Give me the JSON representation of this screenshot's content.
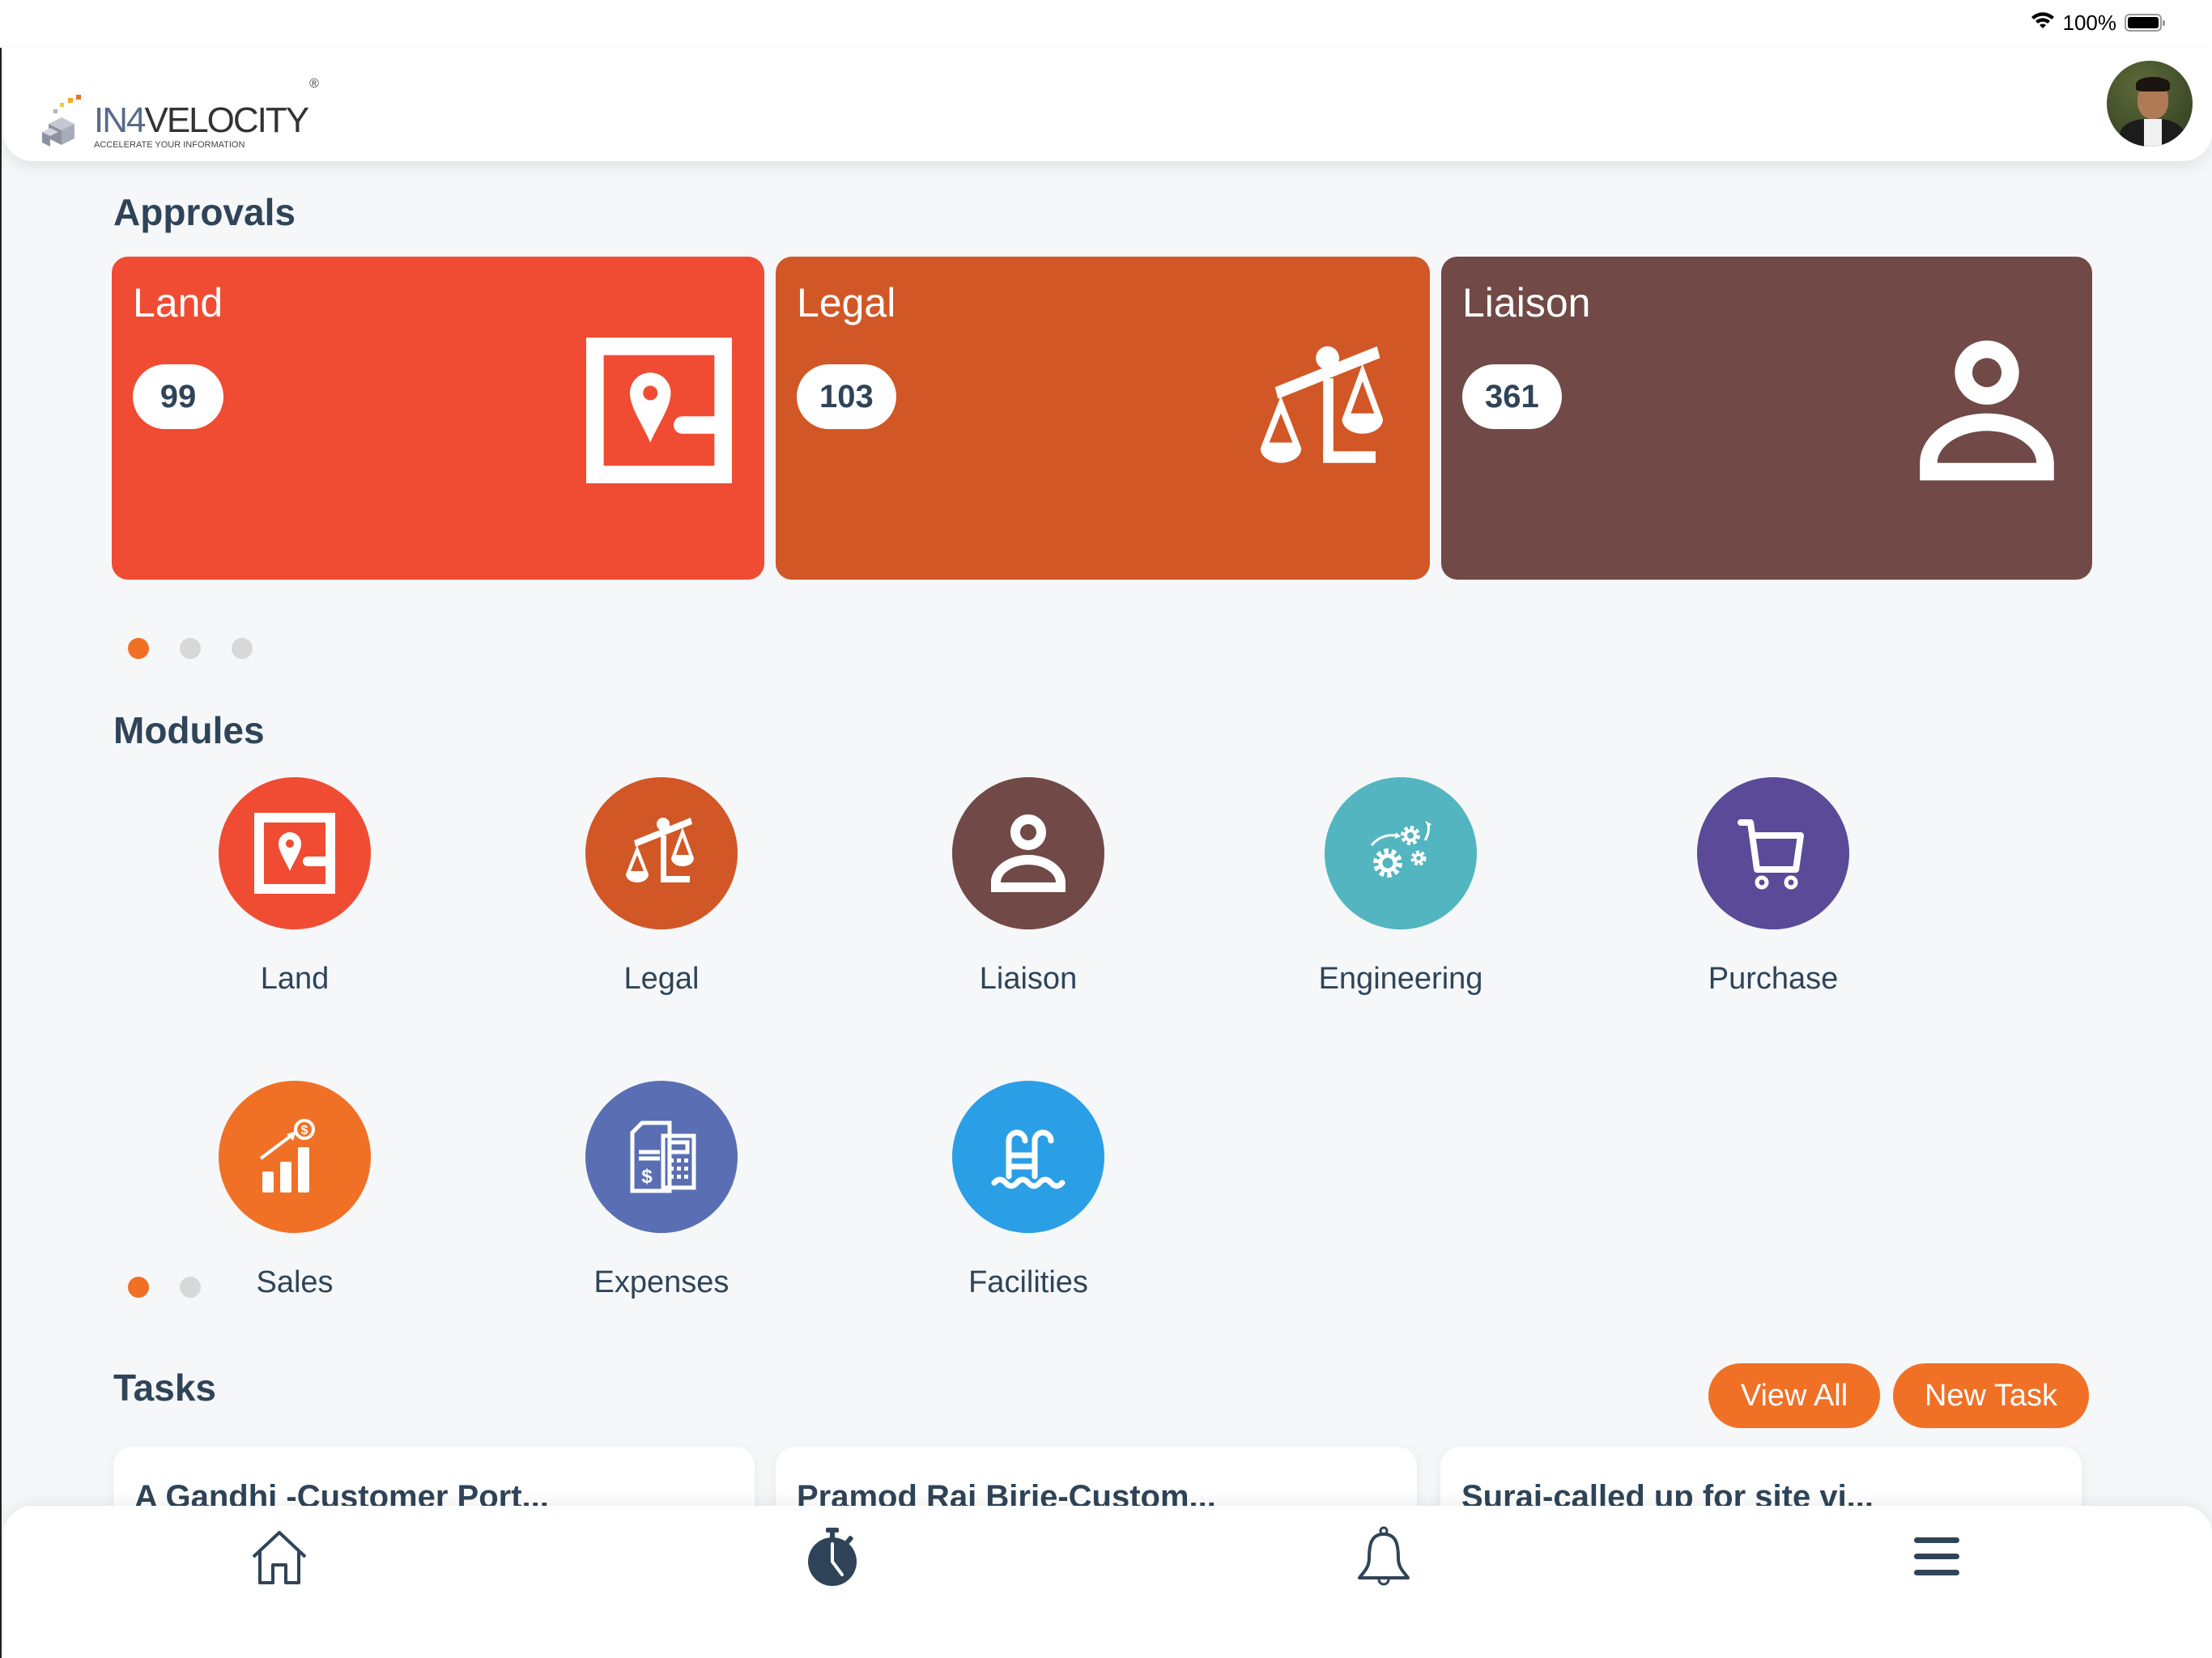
{
  "status_bar": {
    "battery_percent": "100%",
    "battery_level": 1.0,
    "icons": [
      "wifi-icon",
      "battery-icon"
    ]
  },
  "header": {
    "logo": {
      "name_part1": "IN4",
      "name_part2": "VELOCITY",
      "registered": "®",
      "tagline": "ACCELERATE YOUR INFORMATION"
    },
    "avatar_alt": "User profile photo"
  },
  "approvals": {
    "title": "Approvals",
    "cards": [
      {
        "label": "Land",
        "count": "99",
        "color": "#ef4c33",
        "icon": "land-map-pin-icon"
      },
      {
        "label": "Legal",
        "count": "103",
        "color": "#d25726",
        "icon": "scales-icon"
      },
      {
        "label": "Liaison",
        "count": "361",
        "color": "#714946",
        "icon": "person-icon"
      }
    ],
    "pagination": {
      "pages": 3,
      "active": 1
    }
  },
  "modules": {
    "title": "Modules",
    "items": [
      {
        "label": "Land",
        "color": "#ef4c33",
        "icon": "land-map-pin-icon"
      },
      {
        "label": "Legal",
        "color": "#d25726",
        "icon": "scales-icon"
      },
      {
        "label": "Liaison",
        "color": "#714946",
        "icon": "person-icon"
      },
      {
        "label": "Engineering",
        "color": "#52b5bf",
        "icon": "gears-icon"
      },
      {
        "label": "Purchase",
        "color": "#5a4a98",
        "icon": "shopping-cart-icon"
      },
      {
        "label": "Sales",
        "color": "#f07026",
        "icon": "sales-chart-icon"
      },
      {
        "label": "Expenses",
        "color": "#5a6fb3",
        "icon": "expenses-calculator-icon"
      },
      {
        "label": "Facilities",
        "color": "#2b9fe6",
        "icon": "pool-icon"
      }
    ],
    "pagination": {
      "pages": 2,
      "active": 1
    }
  },
  "tasks": {
    "title": "Tasks",
    "view_all_label": "View All",
    "new_task_label": "New Task",
    "accent": "#f07026",
    "items": [
      {
        "title": "A Gandhi -Customer Port..."
      },
      {
        "title": "Pramod Raj Birje-Custom..."
      },
      {
        "title": "Suraj-called up for site vi..."
      }
    ]
  },
  "bottom_nav": {
    "items": [
      {
        "name": "home",
        "icon": "home-icon"
      },
      {
        "name": "timer",
        "icon": "stopwatch-icon"
      },
      {
        "name": "notifications",
        "icon": "bell-icon"
      },
      {
        "name": "menu",
        "icon": "hamburger-menu-icon"
      }
    ]
  }
}
